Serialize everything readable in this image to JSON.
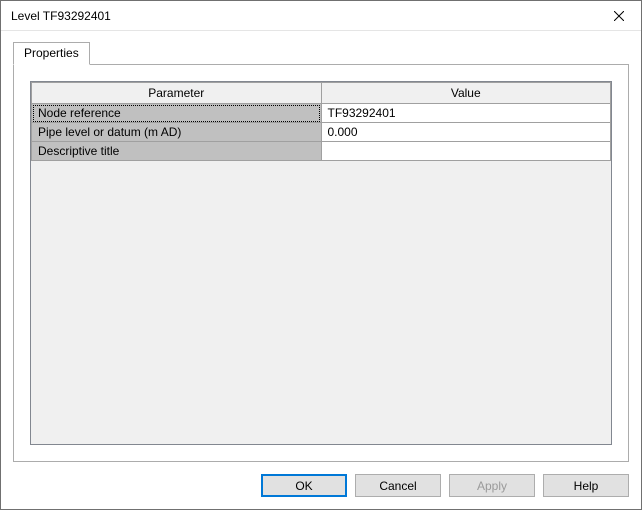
{
  "window": {
    "title": "Level TF93292401"
  },
  "tabs": [
    {
      "label": "Properties"
    }
  ],
  "columns": {
    "parameter": "Parameter",
    "value": "Value"
  },
  "rows": [
    {
      "param": "Node reference",
      "value": "TF93292401",
      "selected": true
    },
    {
      "param": "Pipe level or datum (m AD)",
      "value": "0.000",
      "selected": false
    },
    {
      "param": "Descriptive title",
      "value": "",
      "selected": false
    }
  ],
  "buttons": {
    "ok": "OK",
    "cancel": "Cancel",
    "apply": "Apply",
    "help": "Help"
  }
}
